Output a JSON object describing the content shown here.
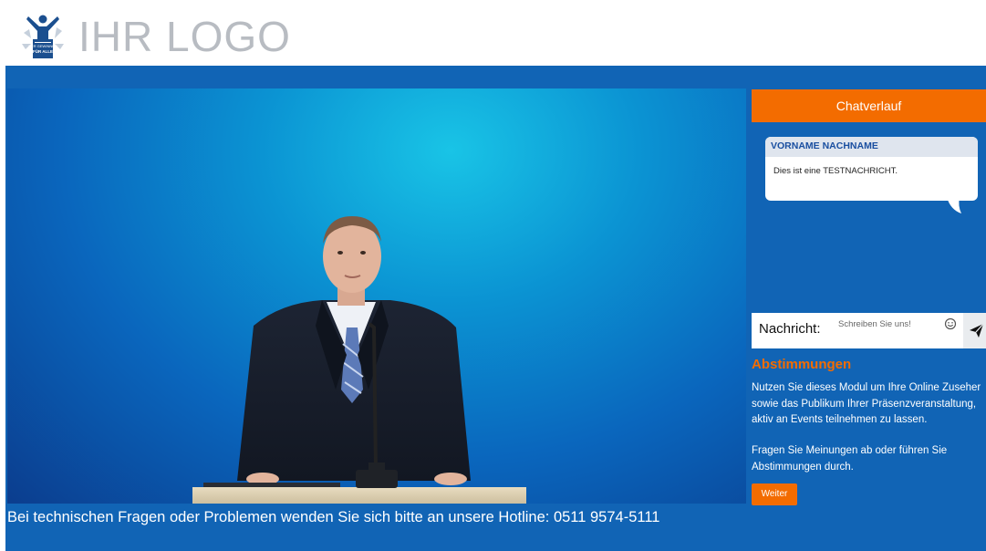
{
  "header": {
    "logo_text": "IHR LOGO",
    "logo_badge_line1": "DER GEWINNER",
    "logo_badge_line2": "FÜR ALLE"
  },
  "video": {
    "hotline_text": "Bei technischen Fragen oder Problemen wenden Sie sich bitte an unsere Hotline: 0511 9574-5111"
  },
  "chat": {
    "header_label": "Chatverlauf",
    "messages": [
      {
        "sender": "VORNAME NACHNAME",
        "text": "Dies ist eine TESTNACHRICHT."
      }
    ],
    "input_label": "Nachricht:",
    "input_placeholder": "Schreiben Sie uns!",
    "emoji_icon": "smiley-icon",
    "send_icon": "paper-plane-icon"
  },
  "poll": {
    "title": "Abstimmungen",
    "description_lines": [
      "Nutzen Sie dieses Modul um Ihre Online Zuseher",
      "sowie das Publikum Ihrer Präsenzveranstaltung,",
      "aktiv an Events teilnehmen zu lassen."
    ],
    "description2": "Fragen Sie Meinungen ab oder führen Sie Abstimmungen durch.",
    "next_label": "Weiter"
  },
  "colors": {
    "page_blue": "#1164b5",
    "accent_orange": "#f36c00",
    "logo_grey": "#b8bcc2"
  }
}
